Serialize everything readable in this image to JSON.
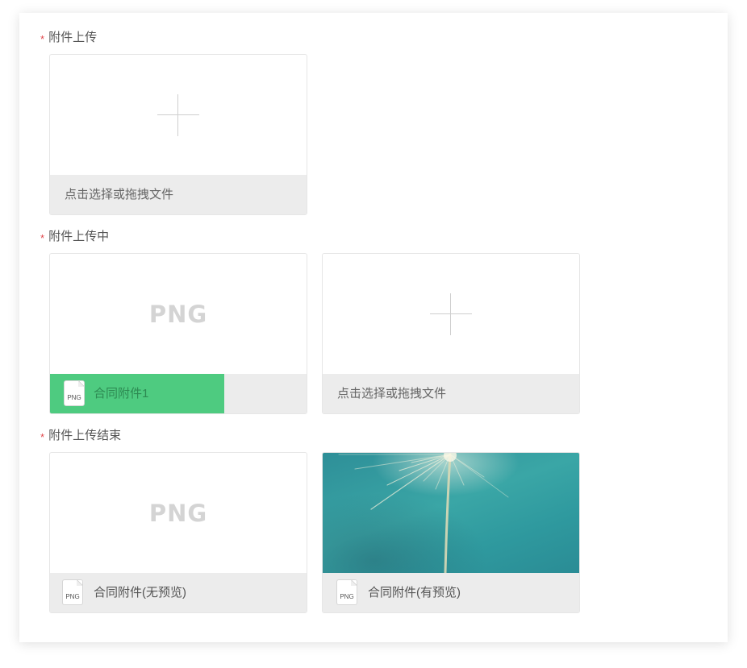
{
  "sections": [
    {
      "label": "附件上传",
      "required": "*"
    },
    {
      "label": "附件上传中",
      "required": "*"
    },
    {
      "label": "附件上传结束",
      "required": "*"
    }
  ],
  "upload_hint": "点击选择或拖拽文件",
  "uploading_file": {
    "placeholder": "PNG",
    "icon_label": "PNG",
    "name": "合同附件1",
    "progress": 0.68
  },
  "done_files": [
    {
      "placeholder": "PNG",
      "icon_label": "PNG",
      "name": "合同附件(无预览)",
      "has_preview": false
    },
    {
      "icon_label": "PNG",
      "name": "合同附件(有预览)",
      "has_preview": true
    }
  ],
  "colors": {
    "required": "#e0454a",
    "progress": "#4ecb80",
    "card_footer": "#ececec"
  },
  "icons": {
    "add": "plus-icon",
    "file": "png-file-icon"
  }
}
